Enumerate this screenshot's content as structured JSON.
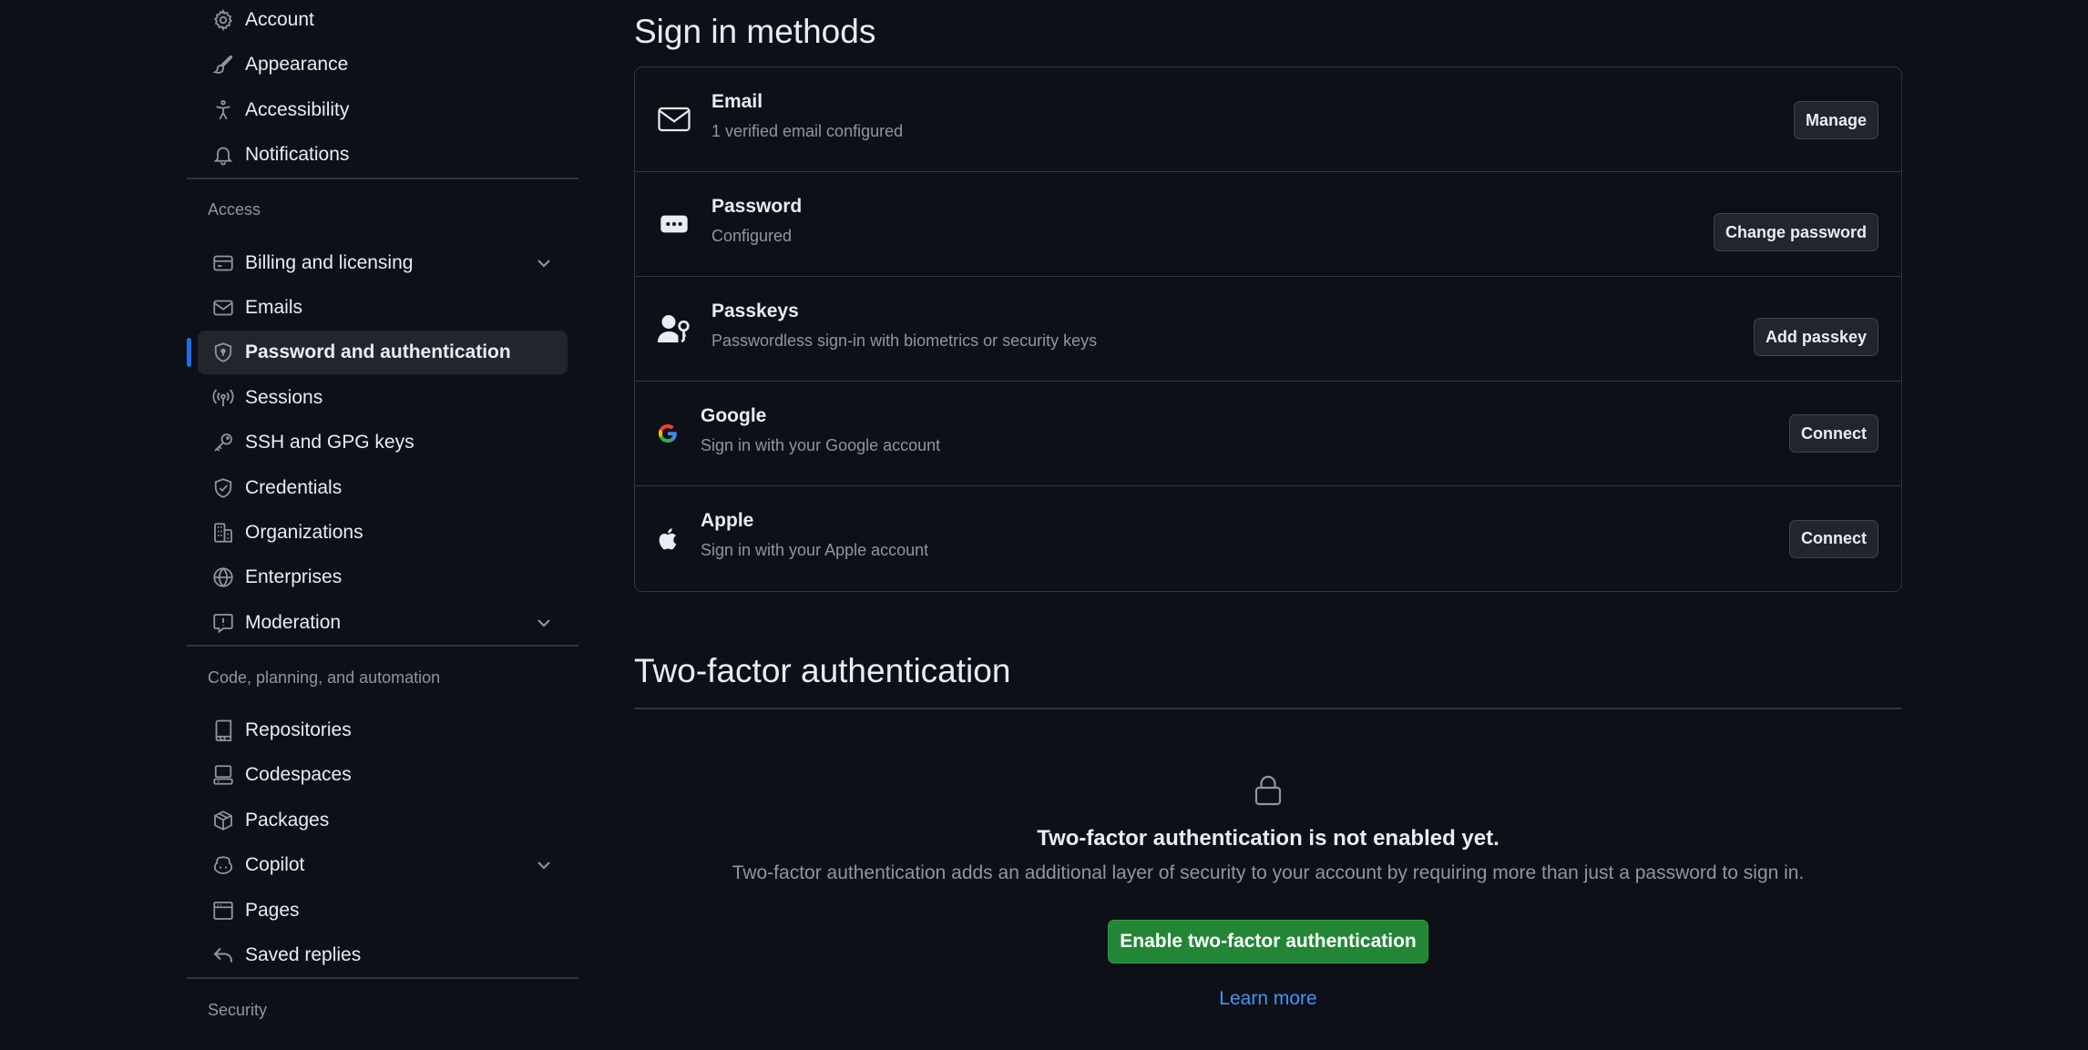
{
  "sidebar": {
    "top_items": [
      {
        "label": "Account",
        "icon": "gear-icon"
      },
      {
        "label": "Appearance",
        "icon": "paintbrush-icon"
      },
      {
        "label": "Accessibility",
        "icon": "accessibility-icon"
      },
      {
        "label": "Notifications",
        "icon": "bell-icon"
      }
    ],
    "access_heading": "Access",
    "access_items": [
      {
        "label": "Billing and licensing",
        "icon": "credit-card-icon",
        "expandable": true
      },
      {
        "label": "Emails",
        "icon": "mail-icon"
      },
      {
        "label": "Password and authentication",
        "icon": "shield-lock-icon",
        "active": true
      },
      {
        "label": "Sessions",
        "icon": "broadcast-icon"
      },
      {
        "label": "SSH and GPG keys",
        "icon": "key-icon"
      },
      {
        "label": "Credentials",
        "icon": "shield-check-icon"
      },
      {
        "label": "Organizations",
        "icon": "organization-icon"
      },
      {
        "label": "Enterprises",
        "icon": "globe-icon"
      },
      {
        "label": "Moderation",
        "icon": "report-icon",
        "expandable": true
      }
    ],
    "code_heading": "Code, planning, and automation",
    "code_items": [
      {
        "label": "Repositories",
        "icon": "repo-icon"
      },
      {
        "label": "Codespaces",
        "icon": "codespaces-icon"
      },
      {
        "label": "Packages",
        "icon": "package-icon"
      },
      {
        "label": "Copilot",
        "icon": "copilot-icon",
        "expandable": true
      },
      {
        "label": "Pages",
        "icon": "browser-icon"
      },
      {
        "label": "Saved replies",
        "icon": "reply-icon"
      }
    ],
    "security_heading": "Security"
  },
  "signin": {
    "title": "Sign in methods",
    "methods": [
      {
        "title": "Email",
        "desc": "1 verified email configured",
        "button": "Manage",
        "icon": "mail-icon"
      },
      {
        "title": "Password",
        "desc": "Configured",
        "button": "Change password",
        "icon": "password-icon"
      },
      {
        "title": "Passkeys",
        "desc": "Passwordless sign-in with biometrics or security keys",
        "button": "Add passkey",
        "icon": "passkey-icon"
      },
      {
        "title": "Google",
        "desc": "Sign in with your Google account",
        "button": "Connect",
        "icon": "google-icon"
      },
      {
        "title": "Apple",
        "desc": "Sign in with your Apple account",
        "button": "Connect",
        "icon": "apple-icon"
      }
    ]
  },
  "two_factor": {
    "title": "Two-factor authentication",
    "heading": "Two-factor authentication is not enabled yet.",
    "description": "Two-factor authentication adds an additional layer of security to your account by requiring more than just a password to sign in.",
    "enable_button": "Enable two-factor authentication",
    "learn_more": "Learn more",
    "icon": "lock-icon"
  },
  "colors": {
    "background": "#0d1117",
    "accent": "#1f6feb",
    "primary_button": "#238636",
    "link": "#4493f8"
  }
}
